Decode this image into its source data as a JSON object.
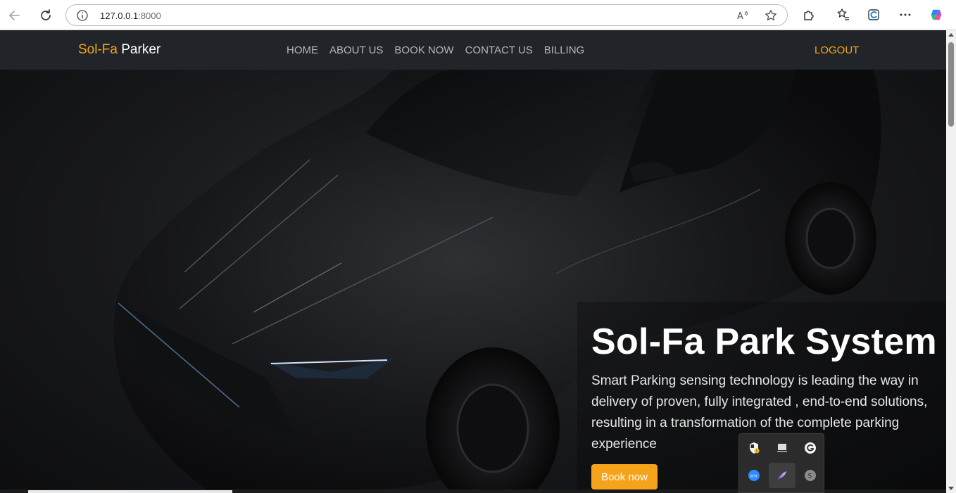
{
  "browser": {
    "url_host": "127.0.0.1",
    "url_port": ":8000"
  },
  "navbar": {
    "brand_accent": "Sol-Fa",
    "brand_rest": " Parker",
    "links": [
      "HOME",
      "ABOUT US",
      "BOOK NOW",
      "CONTACT US",
      "BILLING"
    ],
    "logout": "LOGOUT"
  },
  "hero": {
    "title": "Sol-Fa Park System",
    "description": "Smart Parking sensing technology is leading the way in delivery of proven, fully integrated , end-to-end solutions, resulting in a transformation of the complete parking experience",
    "button_label": "Book now"
  },
  "colors": {
    "accent": "#f5a31a",
    "navbar_bg": "#212529",
    "nav_link": "#b4b7ba"
  },
  "icons": {
    "browser": [
      "back-icon",
      "reload-icon",
      "info-icon",
      "read-aloud-icon",
      "favorite-star-icon",
      "extensions-icon",
      "favorites-icon",
      "collections-icon",
      "more-icon",
      "copilot-icon"
    ],
    "tray": [
      "security-shield-icon",
      "display-icon",
      "grammarly-icon",
      "zoom-icon",
      "feather-pen-icon",
      "skype-icon"
    ]
  }
}
